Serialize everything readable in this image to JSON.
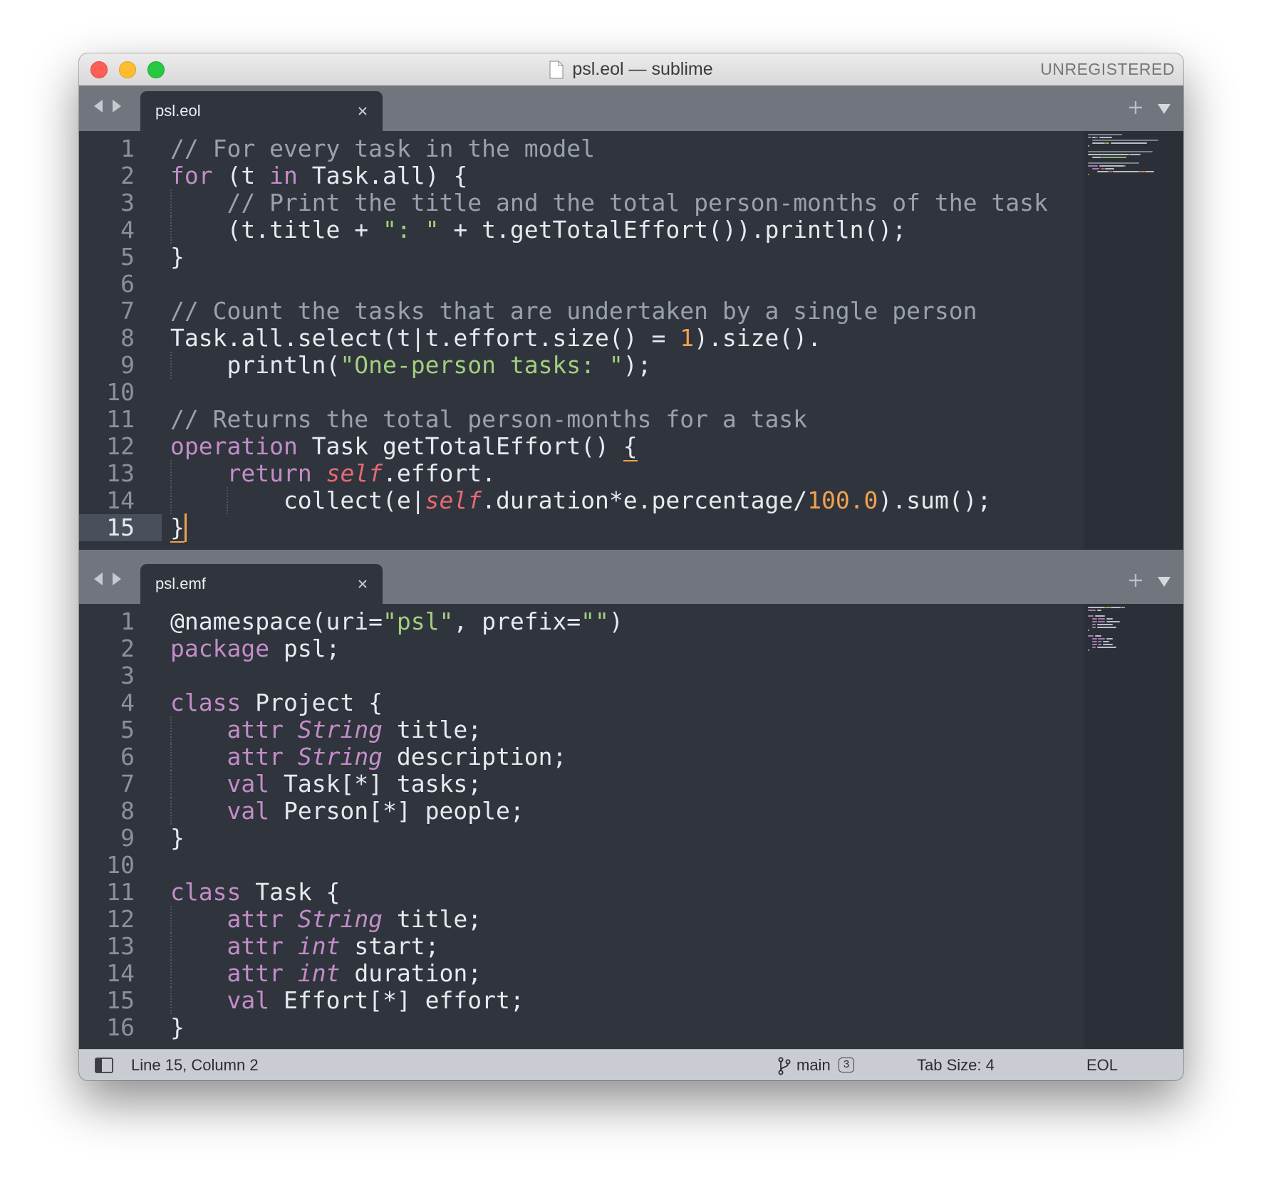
{
  "window": {
    "title": "psl.eol — sublime",
    "registration": "UNREGISTERED"
  },
  "panes": [
    {
      "tab": "psl.eol",
      "active_line": 15,
      "lines": [
        [
          [
            "// For every task in the model",
            "comment"
          ]
        ],
        [
          [
            "for",
            "kw"
          ],
          [
            " (t ",
            ""
          ],
          [
            "in",
            "kw"
          ],
          [
            " Task.all) {",
            ""
          ]
        ],
        [
          [
            "    ",
            ""
          ],
          [
            "// Print the title and the total person-months of the task",
            "comment"
          ]
        ],
        [
          [
            "    (t.title + ",
            ""
          ],
          [
            "\": \"",
            "str"
          ],
          [
            " + t.getTotalEffort()).println();",
            ""
          ]
        ],
        [
          [
            "}",
            ""
          ]
        ],
        [],
        [
          [
            "// Count the tasks that are undertaken by a single person",
            "comment"
          ]
        ],
        [
          [
            "Task.all.select(t|t.effort.size() = ",
            ""
          ],
          [
            "1",
            "num"
          ],
          [
            ").size().",
            ""
          ]
        ],
        [
          [
            "    println(",
            ""
          ],
          [
            "\"One-person tasks: \"",
            "str"
          ],
          [
            ");",
            ""
          ]
        ],
        [],
        [
          [
            "// Returns the total person-months for a task",
            "comment"
          ]
        ],
        [
          [
            "operation",
            "kw"
          ],
          [
            " Task getTotalEffort() ",
            ""
          ],
          [
            "{",
            "bracket"
          ]
        ],
        [
          [
            "    ",
            ""
          ],
          [
            "return",
            "kw"
          ],
          [
            " ",
            ""
          ],
          [
            "self",
            "self"
          ],
          [
            ".effort.",
            ""
          ]
        ],
        [
          [
            "        collect(e|",
            ""
          ],
          [
            "self",
            "self"
          ],
          [
            ".duration*e.percentage/",
            ""
          ],
          [
            "100.0",
            "num"
          ],
          [
            ").sum();",
            ""
          ]
        ],
        [
          [
            "}",
            "bracket"
          ]
        ]
      ]
    },
    {
      "tab": "psl.emf",
      "active_line": 0,
      "lines": [
        [
          [
            "@namespace(uri=",
            ""
          ],
          [
            "\"psl\"",
            "str"
          ],
          [
            ", prefix=",
            ""
          ],
          [
            "\"\"",
            "str"
          ],
          [
            ")",
            ""
          ]
        ],
        [
          [
            "package",
            "kw"
          ],
          [
            " psl;",
            ""
          ]
        ],
        [],
        [
          [
            "class",
            "kw"
          ],
          [
            " Project {",
            ""
          ]
        ],
        [
          [
            "    ",
            ""
          ],
          [
            "attr",
            "kw"
          ],
          [
            " ",
            ""
          ],
          [
            "String",
            "type"
          ],
          [
            " title;",
            ""
          ]
        ],
        [
          [
            "    ",
            ""
          ],
          [
            "attr",
            "kw"
          ],
          [
            " ",
            ""
          ],
          [
            "String",
            "type"
          ],
          [
            " description;",
            ""
          ]
        ],
        [
          [
            "    ",
            ""
          ],
          [
            "val",
            "kw"
          ],
          [
            " Task[*] tasks;",
            ""
          ]
        ],
        [
          [
            "    ",
            ""
          ],
          [
            "val",
            "kw"
          ],
          [
            " Person[*] people;",
            ""
          ]
        ],
        [
          [
            "}",
            ""
          ]
        ],
        [],
        [
          [
            "class",
            "kw"
          ],
          [
            " Task {",
            ""
          ]
        ],
        [
          [
            "    ",
            ""
          ],
          [
            "attr",
            "kw"
          ],
          [
            " ",
            ""
          ],
          [
            "String",
            "type"
          ],
          [
            " title;",
            ""
          ]
        ],
        [
          [
            "    ",
            ""
          ],
          [
            "attr",
            "kw"
          ],
          [
            " ",
            ""
          ],
          [
            "int",
            "type"
          ],
          [
            " start;",
            ""
          ]
        ],
        [
          [
            "    ",
            ""
          ],
          [
            "attr",
            "kw"
          ],
          [
            " ",
            ""
          ],
          [
            "int",
            "type"
          ],
          [
            " duration;",
            ""
          ]
        ],
        [
          [
            "    ",
            ""
          ],
          [
            "val",
            "kw"
          ],
          [
            " Effort[*] effort;",
            ""
          ]
        ],
        [
          [
            "}",
            ""
          ]
        ]
      ]
    }
  ],
  "status": {
    "position": "Line 15, Column 2",
    "branch": "main",
    "changes": "3",
    "tab_size": "Tab Size: 4",
    "syntax": "EOL"
  },
  "colors": {
    "editor_bg": "#2f343d",
    "tabbar_bg": "#70757e",
    "comment": "#9aa1ac",
    "keyword": "#c38dc8",
    "string": "#a2cf7d",
    "number": "#f0a24d",
    "self": "#e56a73",
    "caret": "#f0a24d"
  }
}
